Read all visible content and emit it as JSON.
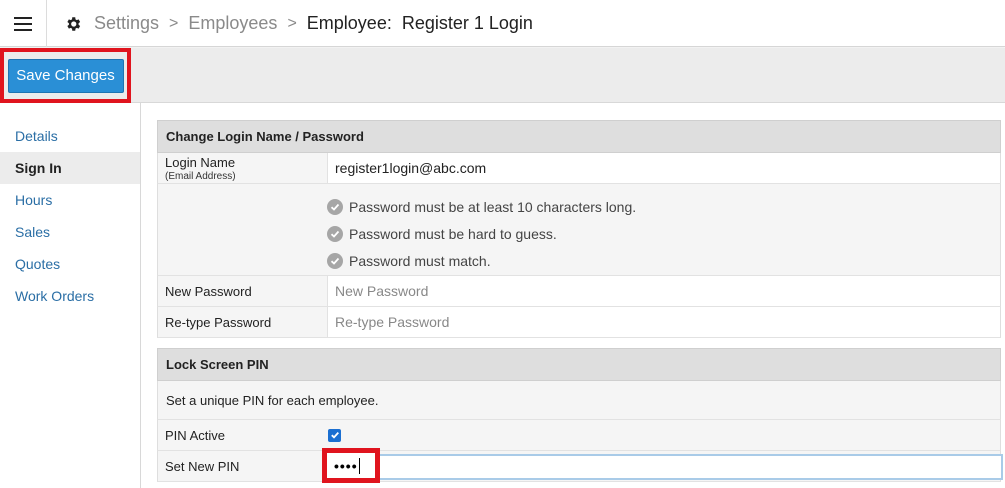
{
  "header": {
    "breadcrumbs": [
      "Settings",
      "Employees",
      "Employee:  Register 1 Login"
    ],
    "separator": ">"
  },
  "toolbar": {
    "save_label": "Save Changes"
  },
  "sidebar": {
    "items": [
      {
        "label": "Details",
        "active": false
      },
      {
        "label": "Sign In",
        "active": true
      },
      {
        "label": "Hours",
        "active": false
      },
      {
        "label": "Sales",
        "active": false
      },
      {
        "label": "Quotes",
        "active": false
      },
      {
        "label": "Work Orders",
        "active": false
      }
    ]
  },
  "login_section": {
    "title": "Change Login Name / Password",
    "login_name_label": "Login Name",
    "login_name_sublabel": "(Email Address)",
    "login_name_value": "register1login@abc.com",
    "rules": [
      "Password must be at least 10 characters long.",
      "Password must be hard to guess.",
      "Password must match."
    ],
    "new_password_label": "New Password",
    "new_password_placeholder": "New Password",
    "retype_password_label": "Re-type Password",
    "retype_password_placeholder": "Re-type Password"
  },
  "pin_section": {
    "title": "Lock Screen PIN",
    "note": "Set a unique PIN for each employee.",
    "pin_active_label": "PIN Active",
    "pin_active_checked": true,
    "set_pin_label": "Set New PIN",
    "set_pin_masked": "••••"
  },
  "colors": {
    "accent": "#2a8fd6",
    "highlight": "#e0141e",
    "link": "#2a6ea5"
  },
  "icons": {
    "menu": "hamburger-menu-icon",
    "settings": "gear-icon",
    "rule_check": "check-circle-icon",
    "checkbox": "checkbox-checked-icon"
  }
}
